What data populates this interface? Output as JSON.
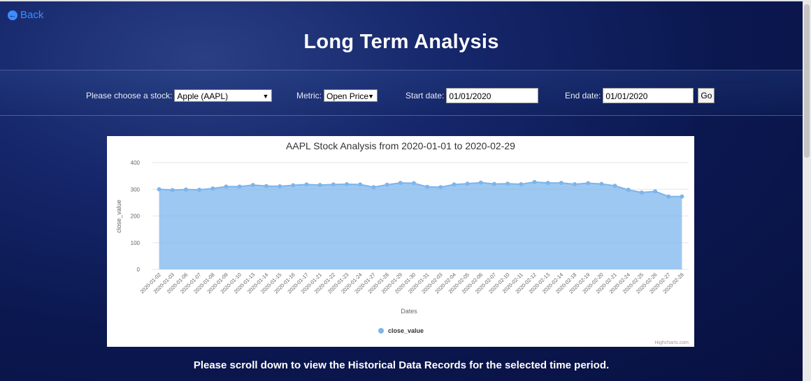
{
  "back": {
    "label": "Back"
  },
  "page": {
    "title": "Long Term Analysis",
    "footer": "Please scroll down to view the Historical Data Records for the selected time period."
  },
  "controls": {
    "stock_label": "Please choose a stock:",
    "stock_value": "Apple (AAPL)",
    "metric_label": "Metric:",
    "metric_value": "Open Price",
    "start_label": "Start date:",
    "start_value": "01/01/2020",
    "end_label": "End date:",
    "end_value": "01/01/2020",
    "go_label": "Go"
  },
  "chart_data": {
    "type": "area",
    "title": "AAPL Stock Analysis from 2020-01-01 to 2020-02-29",
    "xlabel": "Dates",
    "ylabel": "close_value",
    "ylim": [
      0,
      400
    ],
    "yticks": [
      0,
      100,
      200,
      300,
      400
    ],
    "grid": true,
    "legend": "bottom-center",
    "credit": "Highcharts.com",
    "color": "#7cb5ec",
    "x": [
      "2020-01-02",
      "2020-01-03",
      "2020-01-06",
      "2020-01-07",
      "2020-01-08",
      "2020-01-09",
      "2020-01-10",
      "2020-01-13",
      "2020-01-14",
      "2020-01-15",
      "2020-01-16",
      "2020-01-17",
      "2020-01-21",
      "2020-01-22",
      "2020-01-23",
      "2020-01-24",
      "2020-01-27",
      "2020-01-28",
      "2020-01-29",
      "2020-01-30",
      "2020-01-31",
      "2020-02-03",
      "2020-02-04",
      "2020-02-05",
      "2020-02-06",
      "2020-02-07",
      "2020-02-10",
      "2020-02-11",
      "2020-02-12",
      "2020-02-13",
      "2020-02-14",
      "2020-02-18",
      "2020-02-19",
      "2020-02-20",
      "2020-02-21",
      "2020-02-24",
      "2020-02-25",
      "2020-02-26",
      "2020-02-27",
      "2020-02-28"
    ],
    "series": [
      {
        "name": "close_value",
        "values": [
          300,
          297,
          299,
          298,
          303,
          310,
          310,
          316,
          312,
          311,
          315,
          318,
          316,
          318,
          319,
          318,
          308,
          317,
          324,
          323,
          309,
          308,
          318,
          321,
          325,
          320,
          321,
          319,
          327,
          324,
          324,
          319,
          323,
          320,
          313,
          298,
          288,
          292,
          273,
          273
        ]
      }
    ]
  }
}
